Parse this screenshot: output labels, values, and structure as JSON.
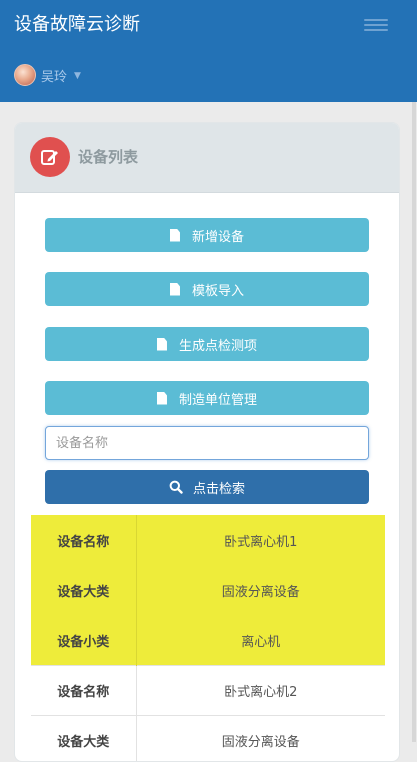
{
  "header": {
    "title": "设备故障云诊断",
    "user_name": "吴玲"
  },
  "panel": {
    "title": "设备列表",
    "buttons": [
      {
        "label": "新增设备"
      },
      {
        "label": "模板导入"
      },
      {
        "label": "生成点检测项"
      },
      {
        "label": "制造单位管理"
      }
    ],
    "search": {
      "placeholder": "设备名称",
      "value": "",
      "button_label": "点击检索"
    }
  },
  "table": {
    "rows": [
      {
        "key": "设备名称",
        "value": "卧式离心机1",
        "highlighted": true
      },
      {
        "key": "设备大类",
        "value": "固液分离设备",
        "highlighted": true
      },
      {
        "key": "设备小类",
        "value": "离心机",
        "highlighted": true
      },
      {
        "key": "设备名称",
        "value": "卧式离心机2",
        "highlighted": false
      },
      {
        "key": "设备大类",
        "value": "固液分离设备",
        "highlighted": false
      }
    ]
  },
  "colors": {
    "header": "#2372b6",
    "info_button": "#5bbcd5",
    "primary_button": "#2f6faa",
    "highlight_row": "#eeec3a",
    "panel_icon": "#e0504f"
  },
  "icons": {
    "menu": "hamburger-icon",
    "panel": "edit-icon",
    "button": "file-icon",
    "search": "search-icon"
  }
}
